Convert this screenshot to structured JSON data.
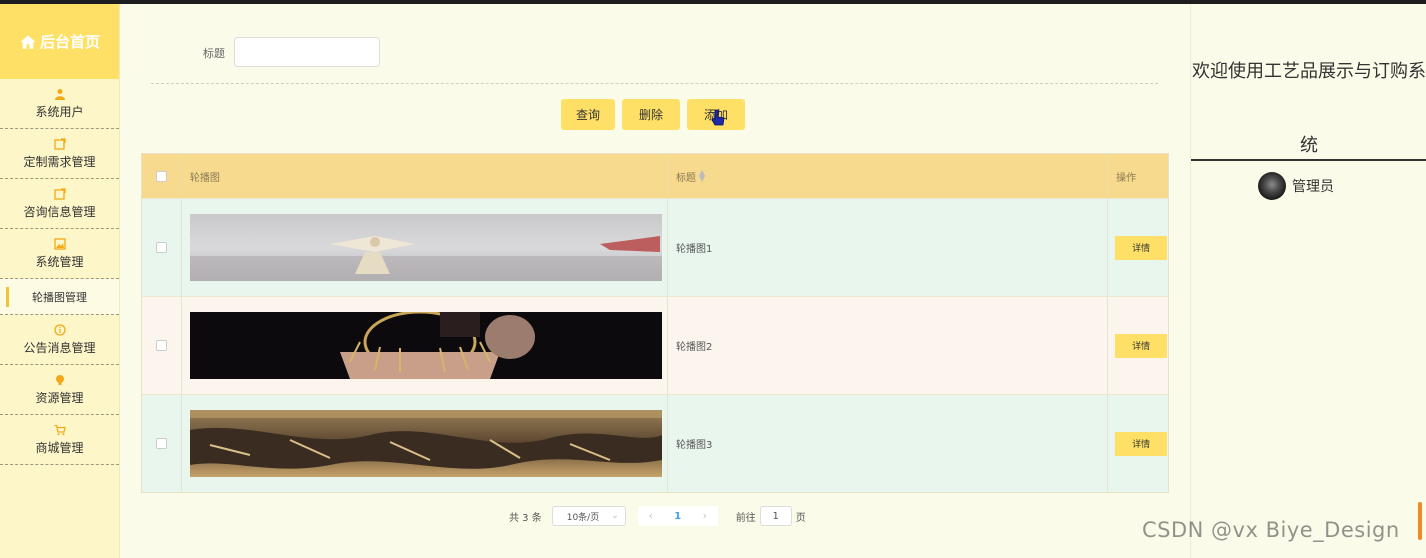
{
  "sidebar": {
    "brand": "后台首页",
    "items": [
      {
        "label": "系统用户",
        "icon": "user-icon"
      },
      {
        "label": "定制需求管理",
        "icon": "edit-icon"
      },
      {
        "label": "咨询信息管理",
        "icon": "edit-icon"
      },
      {
        "label": "系统管理",
        "icon": "image-icon"
      },
      {
        "label": "轮播图管理",
        "icon": "",
        "active": true
      },
      {
        "label": "公告消息管理",
        "icon": "info-icon"
      },
      {
        "label": "资源管理",
        "icon": "bulb-icon"
      },
      {
        "label": "商城管理",
        "icon": "cart-icon"
      }
    ]
  },
  "search": {
    "label": "标题",
    "value": "",
    "placeholder": ""
  },
  "toolbar": {
    "query_label": "查询",
    "delete_label": "删除",
    "add_label": "添加"
  },
  "table": {
    "columns": [
      "轮播图",
      "标题",
      "操作"
    ],
    "rows": [
      {
        "image": "carousel-1",
        "title": "轮播图1",
        "action": "详情"
      },
      {
        "image": "carousel-2",
        "title": "轮播图2",
        "action": "详情"
      },
      {
        "image": "carousel-3",
        "title": "轮播图3",
        "action": "详情"
      }
    ]
  },
  "pagination": {
    "total_text": "共 3 条",
    "page_size": "10条/页",
    "current_page": "1",
    "goto_label": "前往",
    "goto_value": "1",
    "page_suffix": "页"
  },
  "header": {
    "welcome": "欢迎使用工艺品展示与订购系统",
    "user": "管理员"
  },
  "watermark": "CSDN @vx Biye_Design",
  "colors": {
    "accent": "#ffe066",
    "sidebar_bg": "#fcf6c8",
    "table_header": "#f7da8e",
    "row_alt": "#e9f6ee"
  }
}
